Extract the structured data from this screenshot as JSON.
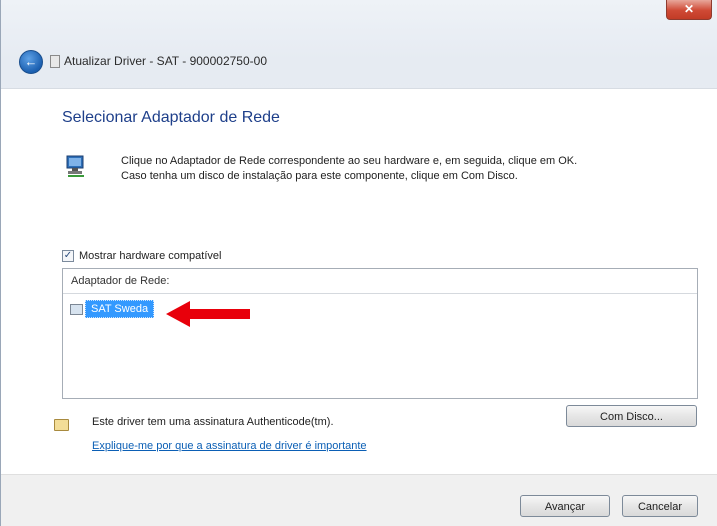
{
  "window": {
    "close_label": "✕"
  },
  "nav": {
    "back_icon": "back-arrow-icon",
    "title": "Atualizar Driver - SAT - 900002750-00"
  },
  "page": {
    "title": "Selecionar Adaptador de Rede",
    "description_line1": "Clique no Adaptador de Rede correspondente ao seu hardware e, em seguida, clique em OK.",
    "description_line2": "Caso tenha um disco de instalação para este componente, clique em Com Disco."
  },
  "compatible_checkbox": {
    "label": "Mostrar hardware compatível",
    "checked": true,
    "mark": "✓"
  },
  "adapter_list": {
    "header": "Adaptador de Rede:",
    "items": [
      {
        "label": "SAT Sweda",
        "selected": true
      }
    ]
  },
  "signature": {
    "text": "Este driver tem uma assinatura Authenticode(tm).",
    "link": "Explique-me por que a assinatura de driver é importante"
  },
  "buttons": {
    "have_disk": "Com Disco...",
    "next": "Avançar",
    "cancel": "Cancelar"
  },
  "colors": {
    "annotation_arrow": "#e8000b",
    "selection": "#3399ff",
    "title_blue": "#1e3f8a",
    "link": "#0b5fb5"
  }
}
